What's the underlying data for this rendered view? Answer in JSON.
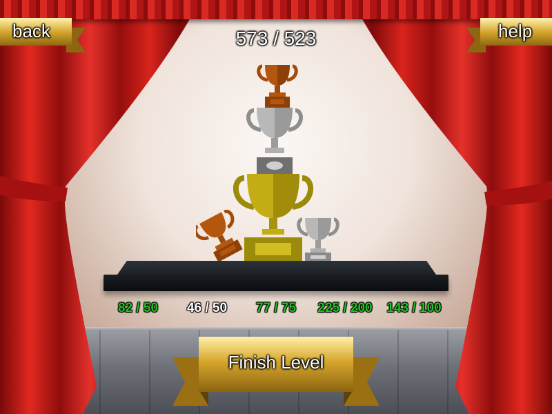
{
  "score": {
    "text": "573 / 523"
  },
  "buttons": {
    "back_label": "back",
    "help_label": "help",
    "finish_label": "Finish Level"
  },
  "trophies": [
    {
      "kind": "bronze-cup",
      "icon": "bronze-trophy-icon"
    },
    {
      "kind": "silver-cup",
      "icon": "silver-trophy-icon"
    },
    {
      "kind": "gold-cup",
      "icon": "gold-trophy-icon"
    },
    {
      "kind": "silver-small-cup",
      "icon": "small-silver-trophy-icon"
    },
    {
      "kind": "bronze-tipped-cup",
      "icon": "tipped-bronze-trophy-icon"
    }
  ],
  "stats": [
    {
      "text": "82 / 50",
      "color": "#1ec41e"
    },
    {
      "text": "46 / 50",
      "color": "#ffffff"
    },
    {
      "text": "77 / 75",
      "color": "#1ec41e"
    },
    {
      "text": "225 / 200",
      "color": "#1ec41e"
    },
    {
      "text": "143 / 100",
      "color": "#1ec41e"
    }
  ],
  "colors": {
    "curtain_red": "#c8161a",
    "ribbon_gold": "#d4a82a",
    "gold_trophy": "#b8a210",
    "silver_trophy": "#a8a8a8",
    "bronze_trophy": "#b5560f"
  }
}
